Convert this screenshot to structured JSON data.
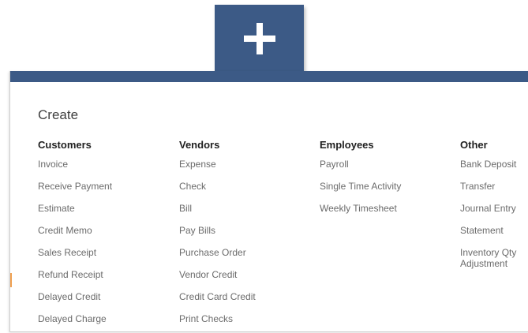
{
  "plus_button": {
    "icon": "plus-icon",
    "color": "#3c5a86"
  },
  "panel": {
    "title": "Create",
    "columns": [
      {
        "heading": "Customers",
        "items": [
          "Invoice",
          "Receive Payment",
          "Estimate",
          "Credit Memo",
          "Sales Receipt",
          "Refund Receipt",
          "Delayed Credit",
          "Delayed Charge"
        ]
      },
      {
        "heading": "Vendors",
        "items": [
          "Expense",
          "Check",
          "Bill",
          "Pay Bills",
          "Purchase Order",
          "Vendor Credit",
          "Credit Card Credit",
          "Print Checks"
        ]
      },
      {
        "heading": "Employees",
        "items": [
          "Payroll",
          "Single Time Activity",
          "Weekly Timesheet"
        ]
      },
      {
        "heading": "Other",
        "items": [
          "Bank Deposit",
          "Transfer",
          "Journal Entry",
          "Statement",
          "Inventory Qty Adjustment"
        ]
      }
    ]
  },
  "colors": {
    "header": "#3c5a86",
    "heading_text": "#1f1f1f",
    "item_text": "#6b6b6b"
  }
}
